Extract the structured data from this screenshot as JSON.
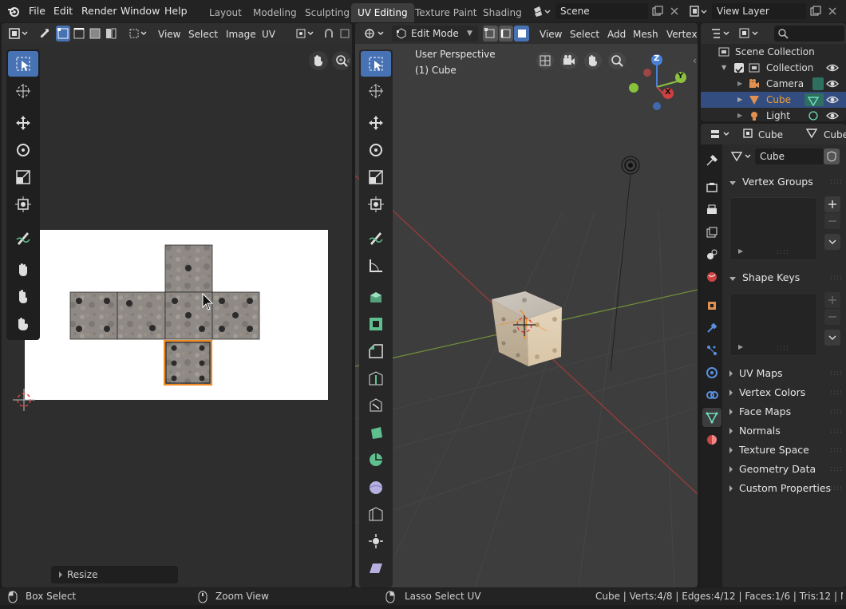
{
  "top_menu": {
    "file": "File",
    "edit": "Edit",
    "render": "Render",
    "window": "Window",
    "help": "Help"
  },
  "workspaces": [
    {
      "label": "Layout"
    },
    {
      "label": "Modeling"
    },
    {
      "label": "Sculpting"
    },
    {
      "label": "UV Editing"
    },
    {
      "label": "Texture Paint"
    },
    {
      "label": "Shading"
    }
  ],
  "scene": {
    "name": "Scene",
    "view_layer": "View Layer"
  },
  "uv_editor": {
    "menus": {
      "view": "View",
      "select": "Select",
      "image": "Image",
      "uv": "UV"
    },
    "resize_panel": "Resize"
  },
  "viewport": {
    "mode": "Edit Mode",
    "menus": {
      "view": "View",
      "select": "Select",
      "add": "Add",
      "mesh": "Mesh",
      "vertex": "Vertex"
    },
    "overlay_line1": "User Perspective",
    "overlay_line2": "(1) Cube",
    "gizmo": {
      "x": "X",
      "y": "Y",
      "z": "Z"
    }
  },
  "outliner": {
    "scene_collection": "Scene Collection",
    "collection": "Collection",
    "items": [
      {
        "label": "Camera"
      },
      {
        "label": "Cube"
      },
      {
        "label": "Light"
      }
    ]
  },
  "properties": {
    "object_name": "Cube",
    "data_name": "Cube",
    "mesh_name": "Cube",
    "panels": {
      "vertex_groups": "Vertex Groups",
      "shape_keys": "Shape Keys",
      "uv_maps": "UV Maps",
      "vertex_colors": "Vertex Colors",
      "face_maps": "Face Maps",
      "normals": "Normals",
      "texture_space": "Texture Space",
      "geometry_data": "Geometry Data",
      "custom_properties": "Custom Properties"
    }
  },
  "status_bar": {
    "box_select": "Box Select",
    "zoom_view": "Zoom View",
    "lasso_select": "Lasso Select UV",
    "stats": "Cube | Verts:4/8 | Edges:4/12 | Faces:1/6 | Tris:12 | Mem: 64.2"
  },
  "colors": {
    "accent": "#4772b3",
    "active_object": "#f0a030",
    "x_axis": "#d04040",
    "y_axis": "#8cc040",
    "z_axis": "#4a80d8"
  }
}
